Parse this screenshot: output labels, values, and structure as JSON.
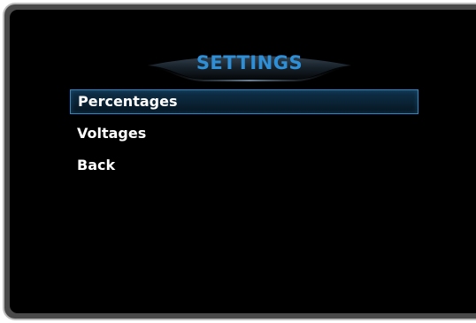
{
  "header": {
    "title": "SETTINGS",
    "accent_color": "#2e8fd6"
  },
  "menu": {
    "items": [
      {
        "label": "Percentages",
        "selected": true
      },
      {
        "label": "Voltages",
        "selected": false
      },
      {
        "label": "Back",
        "selected": false
      }
    ],
    "highlight_color": "#2a86c4"
  }
}
